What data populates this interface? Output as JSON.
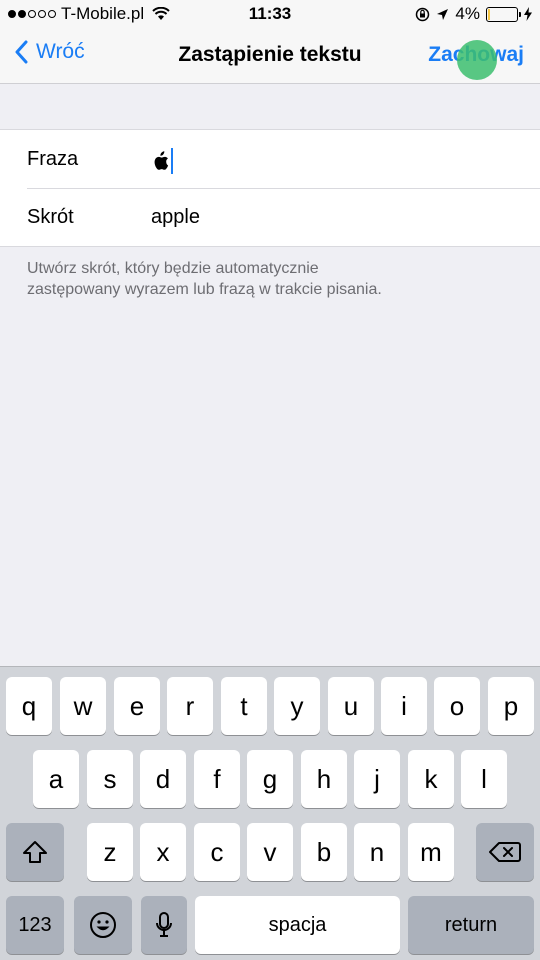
{
  "status_bar": {
    "carrier": "T-Mobile.pl",
    "time": "11:33",
    "battery_percent": "4%",
    "battery_level": 0.04
  },
  "nav": {
    "back_label": "Wróć",
    "title": "Zastąpienie tekstu",
    "save_label": "Zachowaj"
  },
  "form": {
    "phrase_label": "Fraza",
    "phrase_value_icon": "apple-logo-icon",
    "shortcut_label": "Skrót",
    "shortcut_value": "apple"
  },
  "footer_note": "Utwórz skrót, który będzie automatycznie zastępowany wyrazem lub frazą w trakcie pisania.",
  "keyboard": {
    "row1": [
      "q",
      "w",
      "e",
      "r",
      "t",
      "y",
      "u",
      "i",
      "o",
      "p"
    ],
    "row2": [
      "a",
      "s",
      "d",
      "f",
      "g",
      "h",
      "j",
      "k",
      "l"
    ],
    "row3": [
      "z",
      "x",
      "c",
      "v",
      "b",
      "n",
      "m"
    ],
    "numbers_label": "123",
    "space_label": "spacja",
    "return_label": "return"
  },
  "colors": {
    "accent": "#1a7df5",
    "touch_indicator": "#3cbe6e"
  }
}
